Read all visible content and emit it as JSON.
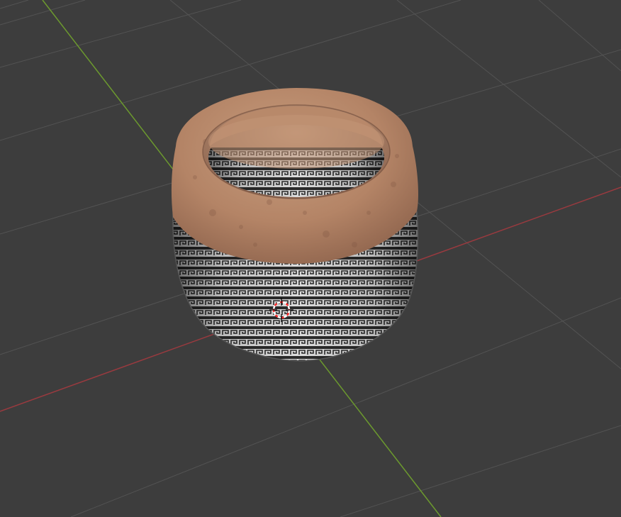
{
  "viewport": {
    "kind": "3d-viewport",
    "background_color": "#3d3d3d",
    "grid_line_color": "#535353",
    "x_axis_color": "#9a3a3f",
    "y_axis_color": "#6c9a2e"
  },
  "object": {
    "shape": "bowl",
    "rim_material_color": "#b8896a",
    "body_pattern": "greek-key",
    "body_base_color": "#d9d9d9",
    "pattern_color": "#2a2a2a"
  },
  "cursor": {
    "icon": "3d-cursor-icon",
    "ring_colors": [
      "#ff2a2a",
      "#ffffff"
    ]
  }
}
